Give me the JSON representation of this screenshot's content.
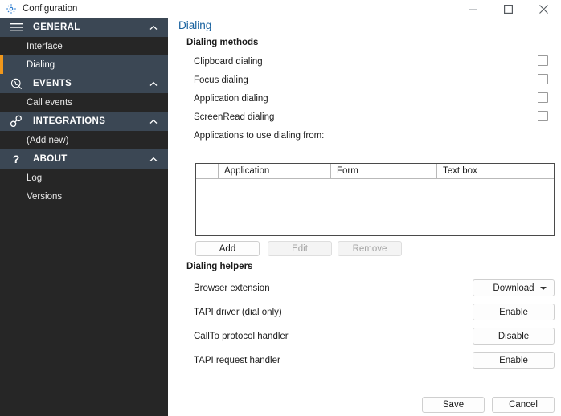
{
  "window": {
    "title": "Configuration",
    "icon": "gear-icon",
    "controls": {
      "minimize": "minimize-icon",
      "maximize": "maximize-icon",
      "close": "close-icon"
    }
  },
  "sidebar": {
    "groups": [
      {
        "label": "GENERAL",
        "icon": "hamburger-icon",
        "chevron": "chevron-up-icon",
        "items": [
          {
            "label": "Interface",
            "selected": false
          },
          {
            "label": "Dialing",
            "selected": true
          }
        ]
      },
      {
        "label": "EVENTS",
        "icon": "call-events-icon",
        "chevron": "chevron-up-icon",
        "items": [
          {
            "label": "Call events",
            "selected": false
          }
        ]
      },
      {
        "label": "INTEGRATIONS",
        "icon": "link-icon",
        "chevron": "chevron-up-icon",
        "items": [
          {
            "label": "(Add new)",
            "selected": false
          }
        ]
      },
      {
        "label": "ABOUT",
        "icon": "question-mark-icon",
        "chevron": "chevron-up-icon",
        "items": [
          {
            "label": "Log",
            "selected": false
          },
          {
            "label": "Versions",
            "selected": false
          }
        ]
      }
    ],
    "accent_color": "#f0971b",
    "header_bg": "#3b4754",
    "item_bg": "#262626"
  },
  "main": {
    "page_title": "Dialing",
    "page_title_color": "#16609e",
    "dialing_methods": {
      "title": "Dialing methods",
      "options": [
        {
          "label": "Clipboard dialing",
          "checked": false
        },
        {
          "label": "Focus dialing",
          "checked": false
        },
        {
          "label": "Application dialing",
          "checked": false
        },
        {
          "label": "ScreenRead dialing",
          "checked": false
        }
      ],
      "applications_label": "Applications to use dialing from:",
      "table": {
        "columns": [
          "",
          "Application",
          "Form",
          "Text box"
        ],
        "rows": []
      },
      "buttons": [
        {
          "label": "Add",
          "enabled": true
        },
        {
          "label": "Edit",
          "enabled": false
        },
        {
          "label": "Remove",
          "enabled": false
        }
      ]
    },
    "dialing_helpers": {
      "title": "Dialing helpers",
      "rows": [
        {
          "label": "Browser extension",
          "action": "Download",
          "type": "dropdown"
        },
        {
          "label": "TAPI driver (dial only)",
          "action": "Enable",
          "type": "button"
        },
        {
          "label": "CallTo protocol handler",
          "action": "Disable",
          "type": "button"
        },
        {
          "label": "TAPI request handler",
          "action": "Enable",
          "type": "button"
        }
      ]
    },
    "footer": {
      "save_label": "Save",
      "cancel_label": "Cancel"
    }
  }
}
